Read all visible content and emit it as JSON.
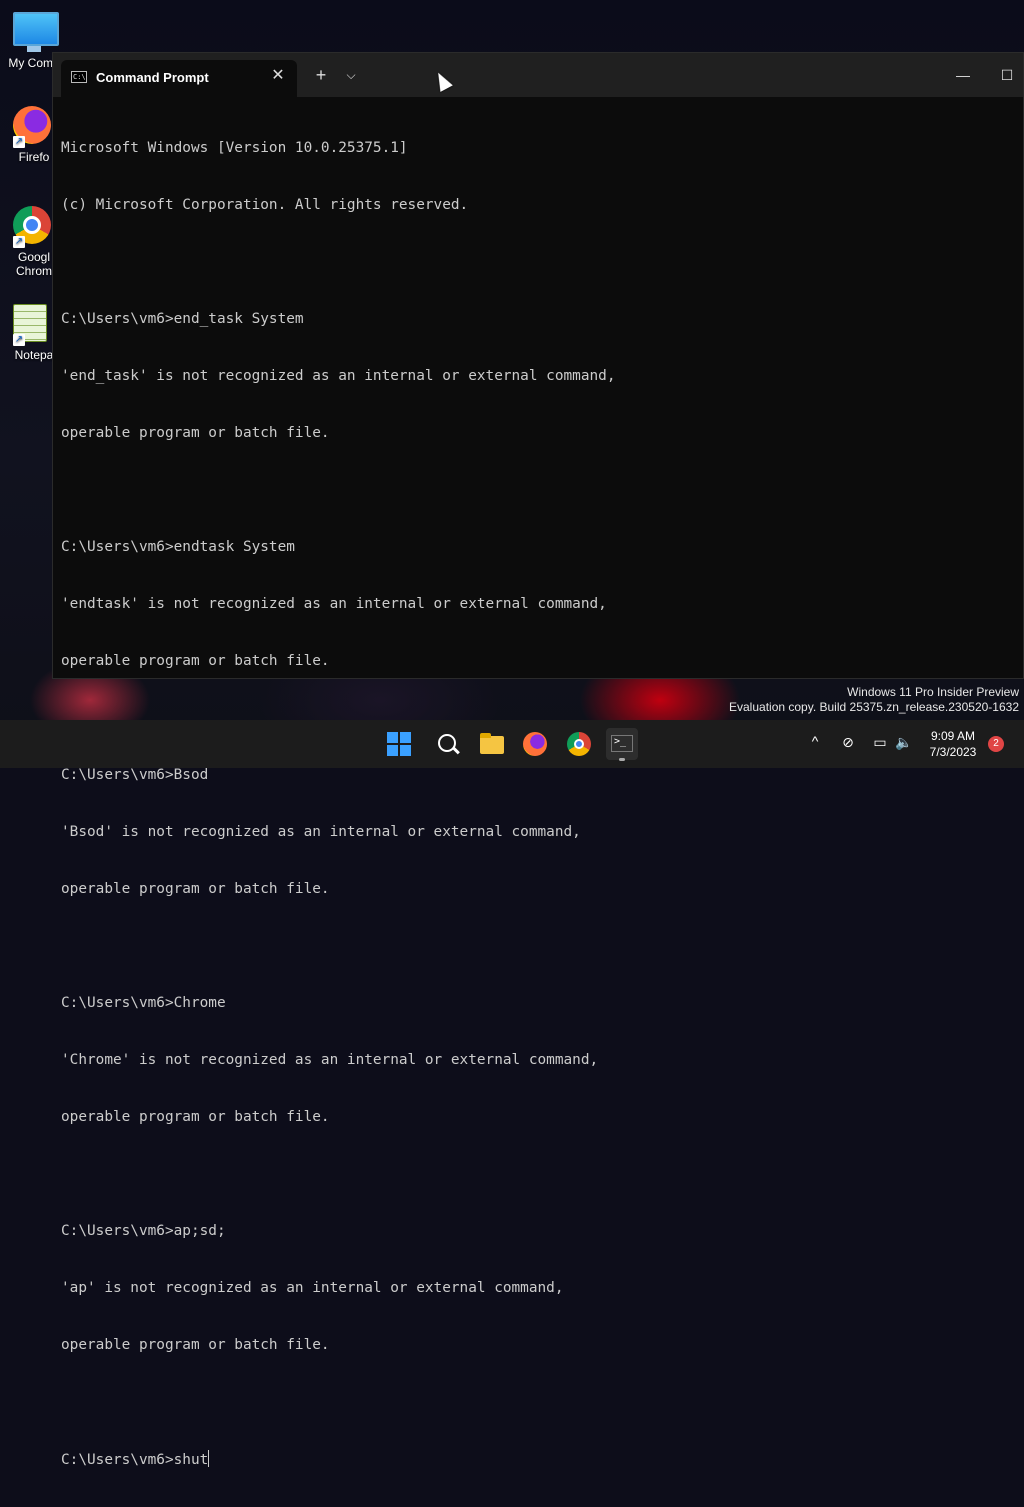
{
  "desktop": {
    "icons": [
      {
        "label": "My Comp"
      },
      {
        "label": "Firefo"
      },
      {
        "label": "Googl",
        "label2": "Chrom"
      },
      {
        "label": "Notepa"
      }
    ]
  },
  "window": {
    "tab_title": "Command Prompt",
    "tab_icon_text": "C:\\",
    "close_glyph": "✕",
    "new_tab_glyph": "+",
    "dropdown_glyph": "⌵",
    "minimize_glyph": "—",
    "maximize_glyph": "☐"
  },
  "console": {
    "lines": [
      "Microsoft Windows [Version 10.0.25375.1]",
      "(c) Microsoft Corporation. All rights reserved.",
      "",
      "C:\\Users\\vm6>end_task System",
      "'end_task' is not recognized as an internal or external command,",
      "operable program or batch file.",
      "",
      "C:\\Users\\vm6>endtask System",
      "'endtask' is not recognized as an internal or external command,",
      "operable program or batch file.",
      "",
      "C:\\Users\\vm6>Bsod",
      "'Bsod' is not recognized as an internal or external command,",
      "operable program or batch file.",
      "",
      "C:\\Users\\vm6>Chrome",
      "'Chrome' is not recognized as an internal or external command,",
      "operable program or batch file.",
      "",
      "C:\\Users\\vm6>ap;sd;",
      "'ap' is not recognized as an internal or external command,",
      "operable program or batch file.",
      ""
    ],
    "prompt": "C:\\Users\\vm6>",
    "current_input": "shut"
  },
  "watermark": {
    "line1": "Windows 11 Pro Insider Preview",
    "line2": "Evaluation copy. Build 25375.zn_release.230520-1632"
  },
  "taskbar": {
    "apps": [
      "start-icon",
      "search-icon",
      "file-explorer-icon",
      "firefox-icon",
      "chrome-icon",
      "terminal-icon"
    ],
    "tray": {
      "chevron_glyph": "^",
      "network_glyph": "⊘",
      "display_glyph": "▭",
      "volume_glyph": "🔈"
    },
    "time": "9:09 AM",
    "date": "7/3/2023",
    "notification_count": "2"
  }
}
